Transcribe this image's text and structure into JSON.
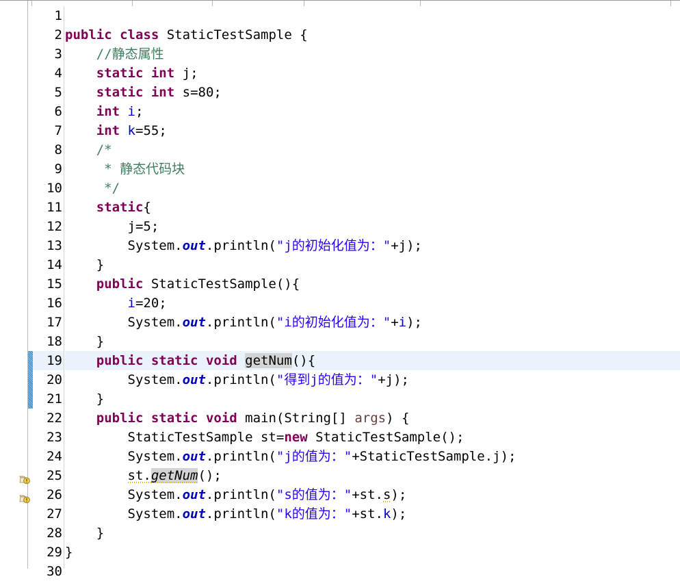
{
  "app": {
    "kind": "java-code-editor",
    "file_class": "StaticTestSample",
    "language": "Java"
  },
  "colors": {
    "keyword": "#7f0055",
    "string": "#2a00ff",
    "comment": "#3f7f5f",
    "field": "#0000c0",
    "parameter": "#6a3e3e",
    "current_line_bg": "#eaf2fb",
    "occurrence_bg": "#d4d4d4",
    "changebar": "#3a87c8",
    "warning": "#d8b000"
  },
  "editor": {
    "first_visible_line": 1,
    "last_visible_line": 30,
    "current_line": 19,
    "fold_lines": [
      8,
      11,
      15,
      19,
      22
    ],
    "warning_lines": [
      25,
      26
    ],
    "changebar_lines": [
      19,
      20,
      21
    ],
    "occurrence_token": "getNum"
  },
  "lines": [
    {
      "n": "1",
      "indent": 0,
      "text": ""
    },
    {
      "n": "2",
      "indent": 0,
      "text": "public class StaticTestSample {"
    },
    {
      "n": "3",
      "indent": 1,
      "text": "//静态属性"
    },
    {
      "n": "4",
      "indent": 1,
      "text": "static int j;"
    },
    {
      "n": "5",
      "indent": 1,
      "text": "static int s=80;"
    },
    {
      "n": "6",
      "indent": 1,
      "text": "int i;"
    },
    {
      "n": "7",
      "indent": 1,
      "text": "int k=55;"
    },
    {
      "n": "8",
      "indent": 1,
      "text": "/*"
    },
    {
      "n": "9",
      "indent": 1,
      "text": " * 静态代码块"
    },
    {
      "n": "10",
      "indent": 1,
      "text": " */"
    },
    {
      "n": "11",
      "indent": 1,
      "text": "static{"
    },
    {
      "n": "12",
      "indent": 2,
      "text": "j=5;"
    },
    {
      "n": "13",
      "indent": 2,
      "text": "System.out.println(\"j的初始化值为：\"+j);"
    },
    {
      "n": "14",
      "indent": 1,
      "text": "}"
    },
    {
      "n": "15",
      "indent": 1,
      "text": "public StaticTestSample(){"
    },
    {
      "n": "16",
      "indent": 2,
      "text": "i=20;"
    },
    {
      "n": "17",
      "indent": 2,
      "text": "System.out.println(\"i的初始化值为：\"+i);"
    },
    {
      "n": "18",
      "indent": 1,
      "text": "}"
    },
    {
      "n": "19",
      "indent": 1,
      "text": "public static void getNum(){"
    },
    {
      "n": "20",
      "indent": 2,
      "text": "System.out.println(\"得到j的值为：\"+j);"
    },
    {
      "n": "21",
      "indent": 1,
      "text": "}"
    },
    {
      "n": "22",
      "indent": 1,
      "text": "public static void main(String[] args) {"
    },
    {
      "n": "23",
      "indent": 2,
      "text": "StaticTestSample st=new StaticTestSample();"
    },
    {
      "n": "24",
      "indent": 2,
      "text": "System.out.println(\"j的值为：\"+StaticTestSample.j);"
    },
    {
      "n": "25",
      "indent": 2,
      "text": "st.getNum();"
    },
    {
      "n": "26",
      "indent": 2,
      "text": "System.out.println(\"s的值为：\"+st.s);"
    },
    {
      "n": "27",
      "indent": 2,
      "text": "System.out.println(\"k的值为：\"+st.k);"
    },
    {
      "n": "28",
      "indent": 1,
      "text": "}"
    },
    {
      "n": "29",
      "indent": 0,
      "text": "}"
    },
    {
      "n": "30",
      "indent": 0,
      "text": ""
    }
  ],
  "tokens": {
    "line2": [
      {
        "t": "public",
        "c": "kw"
      },
      {
        "t": " ",
        "c": "plain"
      },
      {
        "t": "class",
        "c": "kw"
      },
      {
        "t": " StaticTestSample {",
        "c": "type"
      }
    ],
    "line3": [
      {
        "t": "//静态属性",
        "c": "cmt"
      }
    ],
    "line4": [
      {
        "t": "static",
        "c": "kw"
      },
      {
        "t": " ",
        "c": "plain"
      },
      {
        "t": "int",
        "c": "kw"
      },
      {
        "t": " ",
        "c": "plain"
      },
      {
        "t": "j",
        "c": "sfield"
      },
      {
        "t": ";",
        "c": "plain"
      }
    ],
    "line5": [
      {
        "t": "static",
        "c": "kw"
      },
      {
        "t": " ",
        "c": "plain"
      },
      {
        "t": "int",
        "c": "kw"
      },
      {
        "t": " ",
        "c": "plain"
      },
      {
        "t": "s",
        "c": "sfield"
      },
      {
        "t": "=80;",
        "c": "plain"
      }
    ],
    "line6": [
      {
        "t": "int",
        "c": "kw"
      },
      {
        "t": " ",
        "c": "plain"
      },
      {
        "t": "i",
        "c": "field"
      },
      {
        "t": ";",
        "c": "plain"
      }
    ],
    "line7": [
      {
        "t": "int",
        "c": "kw"
      },
      {
        "t": " ",
        "c": "plain"
      },
      {
        "t": "k",
        "c": "field"
      },
      {
        "t": "=55;",
        "c": "plain"
      }
    ],
    "line8": [
      {
        "t": "/*",
        "c": "cmtblk"
      }
    ],
    "line9": [
      {
        "t": " * 静态代码块",
        "c": "cmtblk"
      }
    ],
    "line10": [
      {
        "t": " */",
        "c": "cmtblk"
      }
    ],
    "line11": [
      {
        "t": "static",
        "c": "kw"
      },
      {
        "t": "{",
        "c": "plain"
      }
    ],
    "line12": [
      {
        "t": "j",
        "c": "sfield"
      },
      {
        "t": "=5;",
        "c": "plain"
      }
    ],
    "line13": [
      {
        "t": "System.",
        "c": "plain"
      },
      {
        "t": "out",
        "c": "sout"
      },
      {
        "t": ".println(",
        "c": "plain"
      },
      {
        "t": "\"j的初始化值为：\"",
        "c": "str"
      },
      {
        "t": "+",
        "c": "plain"
      },
      {
        "t": "j",
        "c": "sfield"
      },
      {
        "t": ");",
        "c": "plain"
      }
    ],
    "line14": [
      {
        "t": "}",
        "c": "plain"
      }
    ],
    "line15": [
      {
        "t": "public",
        "c": "kw"
      },
      {
        "t": " StaticTestSample(){",
        "c": "plain"
      }
    ],
    "line16": [
      {
        "t": "i",
        "c": "field"
      },
      {
        "t": "=20;",
        "c": "plain"
      }
    ],
    "line17": [
      {
        "t": "System.",
        "c": "plain"
      },
      {
        "t": "out",
        "c": "sout"
      },
      {
        "t": ".println(",
        "c": "plain"
      },
      {
        "t": "\"i的初始化值为：\"",
        "c": "str"
      },
      {
        "t": "+",
        "c": "plain"
      },
      {
        "t": "i",
        "c": "field"
      },
      {
        "t": ");",
        "c": "plain"
      }
    ],
    "line18": [
      {
        "t": "}",
        "c": "plain"
      }
    ],
    "line19": [
      {
        "t": "public",
        "c": "kw"
      },
      {
        "t": " ",
        "c": "plain"
      },
      {
        "t": "static",
        "c": "kw"
      },
      {
        "t": " ",
        "c": "plain"
      },
      {
        "t": "void",
        "c": "kw"
      },
      {
        "t": " ",
        "c": "plain"
      },
      {
        "t": "getNum",
        "c": "plain occ"
      },
      {
        "t": "(){",
        "c": "plain"
      }
    ],
    "line20": [
      {
        "t": "System.",
        "c": "plain"
      },
      {
        "t": "out",
        "c": "sout"
      },
      {
        "t": ".println(",
        "c": "plain"
      },
      {
        "t": "\"得到j的值为：\"",
        "c": "str"
      },
      {
        "t": "+",
        "c": "plain"
      },
      {
        "t": "j",
        "c": "sfield"
      },
      {
        "t": ");",
        "c": "plain"
      }
    ],
    "line21": [
      {
        "t": "}",
        "c": "plain"
      }
    ],
    "line22": [
      {
        "t": "public",
        "c": "kw"
      },
      {
        "t": " ",
        "c": "plain"
      },
      {
        "t": "static",
        "c": "kw"
      },
      {
        "t": " ",
        "c": "plain"
      },
      {
        "t": "void",
        "c": "kw"
      },
      {
        "t": " main(String[] ",
        "c": "plain"
      },
      {
        "t": "args",
        "c": "param"
      },
      {
        "t": ") {",
        "c": "plain"
      }
    ],
    "line23": [
      {
        "t": "StaticTestSample ",
        "c": "plain"
      },
      {
        "t": "st",
        "c": "local"
      },
      {
        "t": "=",
        "c": "plain"
      },
      {
        "t": "new",
        "c": "kw"
      },
      {
        "t": " StaticTestSample();",
        "c": "plain"
      }
    ],
    "line24": [
      {
        "t": "System.",
        "c": "plain"
      },
      {
        "t": "out",
        "c": "sout"
      },
      {
        "t": ".println(",
        "c": "plain"
      },
      {
        "t": "\"j的值为：\"",
        "c": "str"
      },
      {
        "t": "+StaticTestSample.",
        "c": "plain"
      },
      {
        "t": "j",
        "c": "sfield"
      },
      {
        "t": ");",
        "c": "plain"
      }
    ],
    "line25": [
      {
        "t": "st.",
        "c": "plain warnline"
      },
      {
        "t": "getNum",
        "c": "smethod occ warnline"
      },
      {
        "t": "();",
        "c": "plain"
      }
    ],
    "line26": [
      {
        "t": "System.",
        "c": "plain"
      },
      {
        "t": "out",
        "c": "sout"
      },
      {
        "t": ".println(",
        "c": "plain"
      },
      {
        "t": "\"s的值为：\"",
        "c": "str"
      },
      {
        "t": "+st.",
        "c": "plain"
      },
      {
        "t": "s",
        "c": "sfield warnline"
      },
      {
        "t": ");",
        "c": "plain"
      }
    ],
    "line27": [
      {
        "t": "System.",
        "c": "plain"
      },
      {
        "t": "out",
        "c": "sout"
      },
      {
        "t": ".println(",
        "c": "plain"
      },
      {
        "t": "\"k的值为：\"",
        "c": "str"
      },
      {
        "t": "+st.",
        "c": "plain"
      },
      {
        "t": "k",
        "c": "field"
      },
      {
        "t": ");",
        "c": "plain"
      }
    ],
    "line28": [
      {
        "t": "}",
        "c": "plain"
      }
    ],
    "line29": [
      {
        "t": "}",
        "c": "plain"
      }
    ]
  }
}
